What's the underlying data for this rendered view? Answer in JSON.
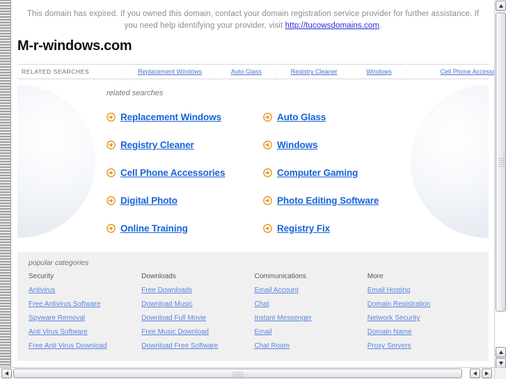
{
  "notice": {
    "text_before": "This domain has expired. If you owned this domain, contact your domain registration service provider for further assistance. If you need help identifying your provider, visit ",
    "link_text": "http://tucowsdomains.com",
    "text_after": "."
  },
  "domain_title": "M-r-windows.com",
  "related_bar": {
    "label": "RELATED SEARCHES",
    "separator": "::",
    "links": [
      "Replacement Windows",
      "Auto Glass",
      "Registry Cleaner",
      "Windows",
      "Cell Phone Accessories"
    ]
  },
  "hero": {
    "caption": "related searches",
    "left_column": [
      "Replacement Windows",
      "Registry Cleaner",
      "Cell Phone Accessories",
      "Digital Photo",
      "Online Training"
    ],
    "right_column": [
      "Auto Glass",
      "Windows",
      "Computer Gaming",
      "Photo Editing Software",
      "Registry Fix"
    ]
  },
  "categories": {
    "caption": "popular categories",
    "columns": [
      {
        "heading": "Security",
        "links": [
          "Antivirus",
          "Free Antivirus Software",
          "Spyware Removal",
          "Anti Virus Software",
          "Free Anti Virus Download"
        ]
      },
      {
        "heading": "Downloads",
        "links": [
          "Free Downloads",
          "Download Music",
          "Download Full Movie",
          "Free Music Download",
          "Download Free Software"
        ]
      },
      {
        "heading": "Communications",
        "links": [
          "Email Account",
          "Chat",
          "Instant Messenger",
          "Email",
          "Chat Room"
        ]
      },
      {
        "heading": "More",
        "links": [
          "Email Hosting",
          "Domain Registration",
          "Network Security",
          "Domain Name",
          "Proxy Servers"
        ]
      }
    ]
  },
  "colors": {
    "link_blue": "#1763d8",
    "nav_link_blue": "#4a6fd4",
    "category_link_blue": "#5a83dd",
    "notice_gray": "#8c8c8c",
    "arrow_orange": "#e8901b",
    "panel_gray": "#f0f0f0"
  },
  "icons": {
    "arrow_circle": "arrow-circle-right-icon",
    "scroll_up": "scroll-up-arrow-icon",
    "scroll_down": "scroll-down-arrow-icon",
    "scroll_left": "scroll-left-arrow-icon",
    "scroll_right": "scroll-right-arrow-icon"
  }
}
